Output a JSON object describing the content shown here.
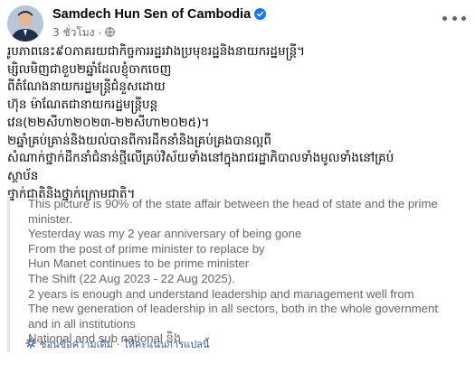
{
  "post": {
    "author": "Samdech Hun Sen of Cambodia",
    "timestamp": "3 ชั่วโมง",
    "khmer_lines": [
      "រូបភាពនេះ៩០ភាគរយជាកិច្ចការរដ្ឋរវាងប្រមុខរដ្ឋនិងនាយករដ្ឋមន្ត្រី។",
      "ម្សិលមិញជាខួប២ឆ្នាំដែលខ្ញុំចាកចេញ",
      "ពីតំណែងនាយករដ្ឋមន្ត្រីជំនួសដោយ",
      "ហ៊ុន ម៉ាណែតជានាយករដ្ឋមន្ត្រីបន្ត",
      "វេន(២២សីហា២០២៣-២២សីហា២០២៥)។",
      "២ឆ្នាំគ្រប់គ្រាន់និងយល់បានពីការដឹកនាំនិងគ្រប់គ្រងបានល្អពី",
      "សំណាក់ថ្នាក់ដឹកនាំជំនាន់ថ្មីលើគ្រប់វិស័យទាំងនៅក្នុងរាជរដ្ឋាភិបាលទាំងមូលទាំងនៅគ្រប់",
      "ស្ថាប័ន",
      "ថ្នាក់ជាតិនិងថ្នាក់ក្រោមជាតិ។"
    ],
    "translation_lines": [
      "This picture is 90% of the state affair between the head of state and the prime",
      "minister.",
      "Yesterday was my 2 year anniversary of being gone",
      "From the post of prime minister to replace by",
      "Hun Manet continues to be prime minister",
      "The Shift (22 Aug 2023 - 22 Aug 2025).",
      "2 years is enough and understand leadership and management well from",
      "The new generation of leadership in all sectors, both in the whole government",
      "and in all institutions",
      "National and sub national និង"
    ],
    "hide_original": "ซ่อนข้อความเดิม",
    "rate_translation": "ให้คะแนนการแปลนี้",
    "separator": "·"
  },
  "colors": {
    "verified": "#1877f2",
    "link": "#385898",
    "muted": "#65676b"
  },
  "icons": {
    "verified": "verified-badge-icon",
    "privacy": "globe-icon",
    "more": "more-options-icon",
    "translate": "translate-gear-icon"
  }
}
